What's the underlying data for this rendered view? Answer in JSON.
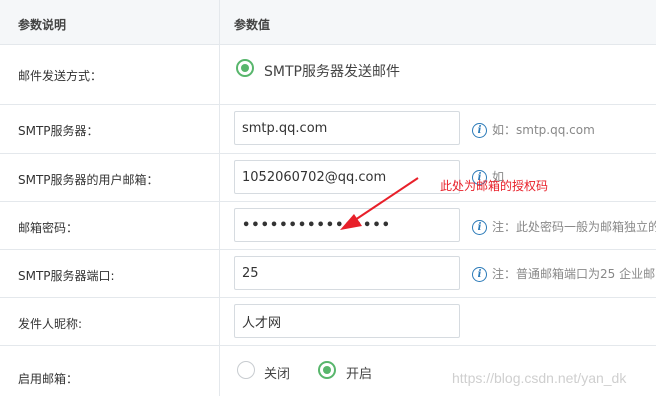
{
  "header": {
    "col1": "参数说明",
    "col2": "参数值"
  },
  "rows": {
    "send_method": {
      "label": "邮件发送方式：",
      "option": "SMTP服务器发送邮件"
    },
    "smtp_server": {
      "label": "SMTP服务器：",
      "value": "smtp.qq.com",
      "hint": "如：smtp.qq.com"
    },
    "smtp_user": {
      "label": "SMTP服务器的用户邮箱：",
      "value": "1052060702@qq.com",
      "hint": "如"
    },
    "password": {
      "label": "邮箱密码：",
      "value": "••••••••••••••••",
      "hint": "注：此处密码一般为邮箱独立的"
    },
    "smtp_port": {
      "label": "SMTP服务器端口:",
      "value": "25",
      "hint": "注：普通邮箱端口为25 企业邮"
    },
    "sender_name": {
      "label": "发件人昵称:",
      "value": "人才网"
    },
    "enable_mail": {
      "label": "启用邮箱：",
      "off_label": "关闭",
      "on_label": "开启",
      "selected": "开启"
    }
  },
  "annotation": {
    "text": "此处为邮箱的授权码",
    "color": "#e8202a"
  },
  "watermark": "https://blog.csdn.net/yan_dk",
  "colors": {
    "accent_green": "#58b66c",
    "info_blue": "#2b7ab8",
    "border": "#e4e8ec"
  },
  "icons": {
    "hint_icon": "info-circle-icon"
  }
}
